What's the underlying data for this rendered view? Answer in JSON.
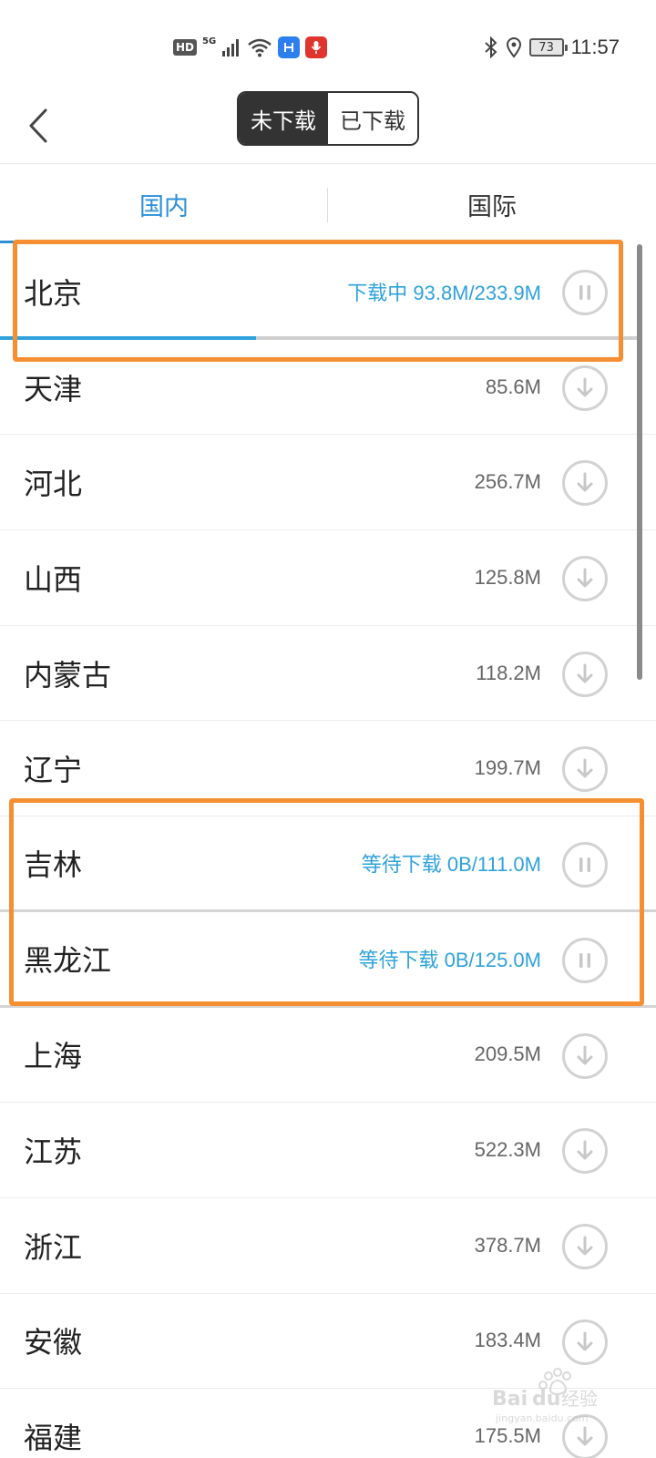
{
  "status_bar": {
    "hd": "HD",
    "network": "5G",
    "battery": "73",
    "time": "11:57"
  },
  "header": {
    "segments": [
      "未下载",
      "已下载"
    ],
    "active_segment": 0
  },
  "tabs": {
    "items": [
      "国内",
      "国际"
    ],
    "active": 0
  },
  "regions": [
    {
      "name": "北京",
      "info": "下载中 93.8M/233.9M",
      "state": "downloading",
      "progress": 0.401
    },
    {
      "name": "天津",
      "info": "85.6M",
      "state": "idle"
    },
    {
      "name": "河北",
      "info": "256.7M",
      "state": "idle"
    },
    {
      "name": "山西",
      "info": "125.8M",
      "state": "idle"
    },
    {
      "name": "内蒙古",
      "info": "118.2M",
      "state": "idle"
    },
    {
      "name": "辽宁",
      "info": "199.7M",
      "state": "idle"
    },
    {
      "name": "吉林",
      "info": "等待下载 0B/111.0M",
      "state": "queued"
    },
    {
      "name": "黑龙江",
      "info": "等待下载 0B/125.0M",
      "state": "queued"
    },
    {
      "name": "上海",
      "info": "209.5M",
      "state": "idle"
    },
    {
      "name": "江苏",
      "info": "522.3M",
      "state": "idle"
    },
    {
      "name": "浙江",
      "info": "378.7M",
      "state": "idle"
    },
    {
      "name": "安徽",
      "info": "183.4M",
      "state": "idle"
    },
    {
      "name": "福建",
      "info": "175.5M",
      "state": "idle"
    }
  ],
  "colors": {
    "accent": "#2b8fd8",
    "highlight": "#f58f32",
    "dark": "#333333"
  },
  "icons": {
    "back": "chevron-left-icon",
    "download": "download-arrow-icon",
    "pause": "pause-icon"
  }
}
